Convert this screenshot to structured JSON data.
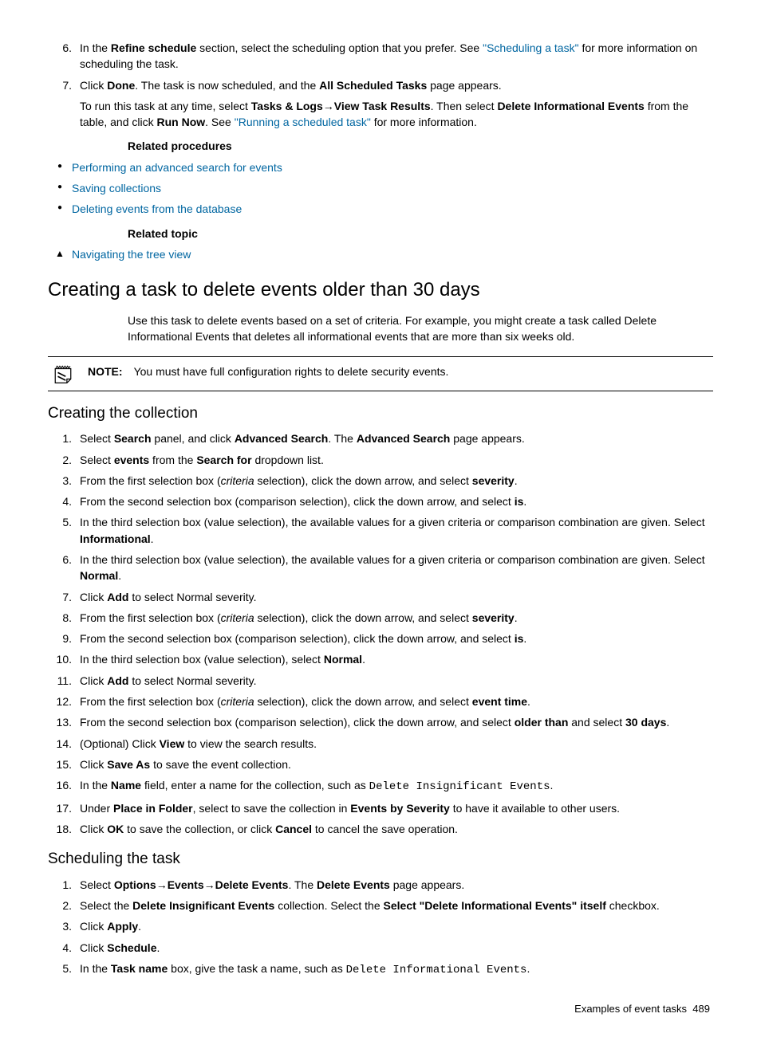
{
  "top_steps": [
    {
      "n": "6.",
      "parts": [
        {
          "t": "In the "
        },
        {
          "t": "Refine schedule",
          "b": true
        },
        {
          "t": " section, select the scheduling option that you prefer. See "
        },
        {
          "t": "\"Scheduling a task\"",
          "link": true
        },
        {
          "t": " for more information on scheduling the task."
        }
      ]
    },
    {
      "n": "7.",
      "parts": [
        {
          "t": "Click "
        },
        {
          "t": "Done",
          "b": true
        },
        {
          "t": ". The task is now scheduled, and the "
        },
        {
          "t": "All Scheduled Tasks",
          "b": true
        },
        {
          "t": " page appears."
        }
      ],
      "sub_parts": [
        {
          "t": "To run this task at any time, select "
        },
        {
          "t": "Tasks & Logs",
          "b": true
        },
        {
          "t": "→"
        },
        {
          "t": "View Task Results",
          "b": true
        },
        {
          "t": ". Then select "
        },
        {
          "t": "Delete Informational Events",
          "b": true
        },
        {
          "t": " from the table, and click "
        },
        {
          "t": "Run Now",
          "b": true
        },
        {
          "t": ". See "
        },
        {
          "t": "\"Running a scheduled task\"",
          "link": true
        },
        {
          "t": " for more information."
        }
      ]
    }
  ],
  "related_procedures_label": "Related procedures",
  "related_procedures": [
    "Performing an advanced search for events",
    "Saving collections",
    "Deleting events from the database"
  ],
  "related_topic_label": "Related topic",
  "related_topic": "Navigating the tree view",
  "h2": "Creating a task to delete events older than 30 days",
  "h2_para": "Use this task to delete events based on a set of criteria. For example, you might create a task called Delete Informational Events that deletes all informational events that are more than six weeks old.",
  "note_label": "NOTE:",
  "note_body": "You must have full configuration rights to delete security events.",
  "h3a": "Creating the collection",
  "creating_steps": [
    {
      "n": "1.",
      "parts": [
        {
          "t": "Select "
        },
        {
          "t": "Search",
          "b": true
        },
        {
          "t": " panel, and click "
        },
        {
          "t": "Advanced Search",
          "b": true
        },
        {
          "t": ". The "
        },
        {
          "t": "Advanced Search",
          "b": true
        },
        {
          "t": " page appears."
        }
      ]
    },
    {
      "n": "2.",
      "parts": [
        {
          "t": "Select "
        },
        {
          "t": "events",
          "b": true
        },
        {
          "t": " from the "
        },
        {
          "t": "Search for",
          "b": true
        },
        {
          "t": " dropdown list."
        }
      ]
    },
    {
      "n": "3.",
      "parts": [
        {
          "t": "From the first selection box ("
        },
        {
          "t": "criteria",
          "i": true
        },
        {
          "t": " selection), click the down arrow, and select "
        },
        {
          "t": "severity",
          "b": true
        },
        {
          "t": "."
        }
      ]
    },
    {
      "n": "4.",
      "parts": [
        {
          "t": "From the second selection box (comparison selection), click the down arrow, and select "
        },
        {
          "t": "is",
          "b": true
        },
        {
          "t": "."
        }
      ]
    },
    {
      "n": "5.",
      "parts": [
        {
          "t": "In the third selection box (value selection), the available values for a given criteria or comparison combination are given. Select "
        },
        {
          "t": "Informational",
          "b": true
        },
        {
          "t": "."
        }
      ]
    },
    {
      "n": "6.",
      "parts": [
        {
          "t": "In the third selection box (value selection), the available values for a given criteria or comparison combination are given. Select "
        },
        {
          "t": "Normal",
          "b": true
        },
        {
          "t": "."
        }
      ]
    },
    {
      "n": "7.",
      "parts": [
        {
          "t": "Click "
        },
        {
          "t": "Add",
          "b": true
        },
        {
          "t": " to select Normal severity."
        }
      ]
    },
    {
      "n": "8.",
      "parts": [
        {
          "t": "From the first selection box ("
        },
        {
          "t": "criteria",
          "i": true
        },
        {
          "t": " selection), click the down arrow, and select "
        },
        {
          "t": "severity",
          "b": true
        },
        {
          "t": "."
        }
      ]
    },
    {
      "n": "9.",
      "parts": [
        {
          "t": "From the second selection box (comparison selection), click the down arrow, and select "
        },
        {
          "t": "is",
          "b": true
        },
        {
          "t": "."
        }
      ]
    },
    {
      "n": "10.",
      "parts": [
        {
          "t": "In the third selection box (value selection), select "
        },
        {
          "t": "Normal",
          "b": true
        },
        {
          "t": "."
        }
      ]
    },
    {
      "n": "11.",
      "parts": [
        {
          "t": "Click "
        },
        {
          "t": "Add",
          "b": true
        },
        {
          "t": " to select Normal severity."
        }
      ]
    },
    {
      "n": "12.",
      "parts": [
        {
          "t": "From the first selection box ("
        },
        {
          "t": "criteria",
          "i": true
        },
        {
          "t": " selection), click the down arrow, and select "
        },
        {
          "t": "event time",
          "b": true
        },
        {
          "t": "."
        }
      ]
    },
    {
      "n": "13.",
      "parts": [
        {
          "t": "From the second selection box (comparison selection), click the down arrow, and select "
        },
        {
          "t": "older than",
          "b": true
        },
        {
          "t": " and select "
        },
        {
          "t": "30 days",
          "b": true
        },
        {
          "t": "."
        }
      ]
    },
    {
      "n": "14.",
      "parts": [
        {
          "t": "(Optional) Click "
        },
        {
          "t": "View",
          "b": true
        },
        {
          "t": " to view the search results."
        }
      ]
    },
    {
      "n": "15.",
      "parts": [
        {
          "t": "Click "
        },
        {
          "t": "Save As",
          "b": true
        },
        {
          "t": " to save the event collection."
        }
      ]
    },
    {
      "n": "16.",
      "parts": [
        {
          "t": "In the "
        },
        {
          "t": "Name",
          "b": true
        },
        {
          "t": " field, enter a name for the collection, such as "
        },
        {
          "t": "Delete Insignificant Events",
          "mono": true
        },
        {
          "t": "."
        }
      ]
    },
    {
      "n": "17.",
      "parts": [
        {
          "t": "Under "
        },
        {
          "t": "Place in Folder",
          "b": true
        },
        {
          "t": ", select to save the collection in "
        },
        {
          "t": "Events by Severity",
          "b": true
        },
        {
          "t": " to have it available to other users."
        }
      ]
    },
    {
      "n": "18.",
      "parts": [
        {
          "t": "Click "
        },
        {
          "t": "OK",
          "b": true
        },
        {
          "t": " to save the collection, or click "
        },
        {
          "t": "Cancel",
          "b": true
        },
        {
          "t": " to cancel the save operation."
        }
      ]
    }
  ],
  "h3b": "Scheduling the task",
  "sched_steps": [
    {
      "n": "1.",
      "parts": [
        {
          "t": "Select "
        },
        {
          "t": "Options",
          "b": true
        },
        {
          "t": "→"
        },
        {
          "t": "Events",
          "b": true
        },
        {
          "t": "→"
        },
        {
          "t": "Delete Events",
          "b": true
        },
        {
          "t": ". The "
        },
        {
          "t": "Delete Events",
          "b": true
        },
        {
          "t": " page appears."
        }
      ]
    },
    {
      "n": "2.",
      "parts": [
        {
          "t": "Select the "
        },
        {
          "t": "Delete Insignificant Events",
          "b": true
        },
        {
          "t": " collection. Select the "
        },
        {
          "t": "Select \"Delete Informational Events\" itself",
          "b": true
        },
        {
          "t": " checkbox."
        }
      ]
    },
    {
      "n": "3.",
      "parts": [
        {
          "t": "Click "
        },
        {
          "t": "Apply",
          "b": true
        },
        {
          "t": "."
        }
      ]
    },
    {
      "n": "4.",
      "parts": [
        {
          "t": "Click "
        },
        {
          "t": "Schedule",
          "b": true
        },
        {
          "t": "."
        }
      ]
    },
    {
      "n": "5.",
      "parts": [
        {
          "t": "In the "
        },
        {
          "t": "Task name",
          "b": true
        },
        {
          "t": " box, give the task a name, such as "
        },
        {
          "t": "Delete Informational Events",
          "mono": true
        },
        {
          "t": "."
        }
      ]
    }
  ],
  "footer_text": "Examples of event tasks",
  "footer_page": "489"
}
